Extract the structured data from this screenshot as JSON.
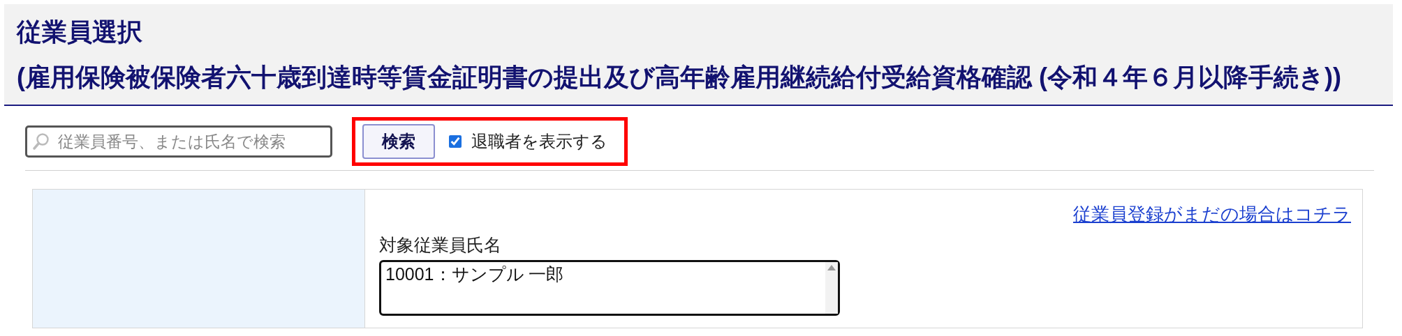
{
  "header": {
    "title": "従業員選択",
    "subtitle": "(雇用保険被保険者六十歳到達時等賃金証明書の提出及び高年齢雇用継続給付受給資格確認 (令和４年６月以降手続き))"
  },
  "search": {
    "placeholder": "従業員番号、または氏名で検索",
    "button": "検索",
    "show_retired": {
      "label": "退職者を表示する",
      "checked": true
    }
  },
  "panel": {
    "register_link": "従業員登録がまだの場合はコチラ",
    "field_label": "対象従業員氏名",
    "options": [
      {
        "label": "10001：サンプル 一郎",
        "selected": false
      }
    ]
  }
}
